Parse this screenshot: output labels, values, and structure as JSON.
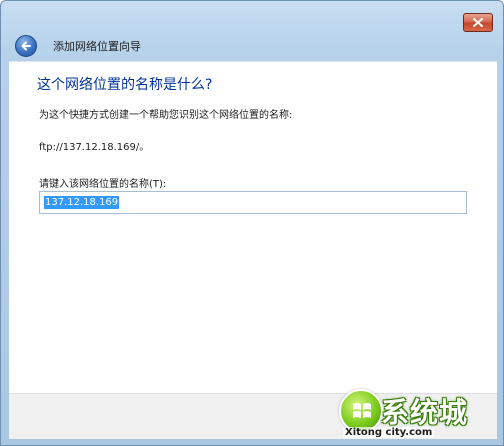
{
  "window": {
    "title": "添加网络位置向导",
    "close_icon": "close-icon",
    "back_icon": "back-arrow-icon"
  },
  "content": {
    "heading": "这个网络位置的名称是什么?",
    "description": "为这个快捷方式创建一个帮助您识别这个网络位置的名称:",
    "address": "ftp://137.12.18.169/。",
    "field_label": "请键入该网络位置的名称(T):",
    "name_value": "137.12.18.169"
  },
  "watermark": {
    "brand": "系统城",
    "url": "Xitong city.com"
  },
  "colors": {
    "heading": "#003399",
    "selection": "#3399ff",
    "frame": "#bcd6ee",
    "watermark_green": "#7ccc1e"
  }
}
